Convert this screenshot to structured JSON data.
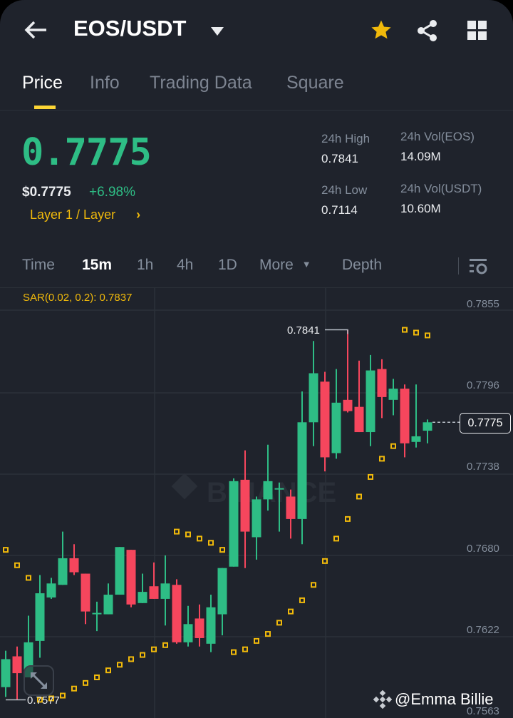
{
  "header": {
    "title": "EOS/USDT",
    "icons": [
      "back-arrow-icon",
      "caret-down-icon",
      "star-icon",
      "share-icon",
      "grid-icon"
    ]
  },
  "tabs": [
    {
      "label": "Price"
    },
    {
      "label": "Info"
    },
    {
      "label": "Trading Data"
    },
    {
      "label": "Square"
    }
  ],
  "ticker": {
    "last_price": "0.7775",
    "usd_price": "$0.7775",
    "change": "+6.98%",
    "category": "Layer 1 / Layer",
    "high_label": "24h High",
    "high": "0.7841",
    "low_label": "24h Low",
    "low": "0.7114",
    "vol_base_label": "24h Vol(EOS)",
    "vol_base": "14.09M",
    "vol_quote_label": "24h Vol(USDT)",
    "vol_quote": "10.60M"
  },
  "timeframes": {
    "items": [
      "Time",
      "15m",
      "1h",
      "4h",
      "1D",
      "More"
    ],
    "active": "15m",
    "depth": "Depth"
  },
  "indicator": {
    "label": "SAR(0.02, 0.2): 0.7837"
  },
  "watermark": "BINANCE",
  "credit": "@Emma Billie",
  "colors": {
    "up": "#2ebd85",
    "down": "#f6465d",
    "sar": "#f0b90b",
    "accent": "#fcd535"
  },
  "chart_data": {
    "type": "candlestick",
    "interval": "15m",
    "y_ticks": [
      "0.7855",
      "0.7796",
      "0.7738",
      "0.7680",
      "0.7622",
      "0.7563"
    ],
    "ylim": [
      0.7563,
      0.7868
    ],
    "current_price": "0.7775",
    "max_label": "0.7841",
    "min_label": "0.7577",
    "candles": [
      [
        0.7586,
        0.7612,
        0.7579,
        0.7606
      ],
      [
        0.7608,
        0.7615,
        0.7577,
        0.7596
      ],
      [
        0.7593,
        0.7637,
        0.7593,
        0.7618
      ],
      [
        0.7619,
        0.7666,
        0.7607,
        0.7653
      ],
      [
        0.765,
        0.7664,
        0.7649,
        0.766
      ],
      [
        0.7659,
        0.7697,
        0.7659,
        0.7678
      ],
      [
        0.7678,
        0.7688,
        0.7666,
        0.7668
      ],
      [
        0.7667,
        0.7667,
        0.7631,
        0.764
      ],
      [
        0.7638,
        0.7647,
        0.7626,
        0.7639
      ],
      [
        0.7638,
        0.766,
        0.7638,
        0.7652
      ],
      [
        0.7652,
        0.7686,
        0.7652,
        0.7686
      ],
      [
        0.7684,
        0.7684,
        0.7643,
        0.7645
      ],
      [
        0.7646,
        0.7667,
        0.7646,
        0.7654
      ],
      [
        0.7658,
        0.7675,
        0.7649,
        0.7649
      ],
      [
        0.7649,
        0.768,
        0.763,
        0.766
      ],
      [
        0.7659,
        0.7663,
        0.7617,
        0.7618
      ],
      [
        0.7618,
        0.7644,
        0.7615,
        0.7631
      ],
      [
        0.7635,
        0.7645,
        0.7615,
        0.7621
      ],
      [
        0.7617,
        0.7652,
        0.7611,
        0.7643
      ],
      [
        0.7638,
        0.7671,
        0.7623,
        0.7671
      ],
      [
        0.7672,
        0.7735,
        0.7672,
        0.7733
      ],
      [
        0.7734,
        0.7755,
        0.7671,
        0.7697
      ],
      [
        0.7693,
        0.7722,
        0.7677,
        0.772
      ],
      [
        0.772,
        0.7759,
        0.7712,
        0.7733
      ],
      [
        0.7727,
        0.7732,
        0.7697,
        0.7728
      ],
      [
        0.7722,
        0.7727,
        0.7692,
        0.7706
      ],
      [
        0.7706,
        0.7797,
        0.7688,
        0.7775
      ],
      [
        0.7775,
        0.7833,
        0.7758,
        0.781
      ],
      [
        0.7804,
        0.7811,
        0.774,
        0.775
      ],
      [
        0.7753,
        0.7813,
        0.7749,
        0.7789
      ],
      [
        0.7791,
        0.7841,
        0.7782,
        0.7783
      ],
      [
        0.7786,
        0.7819,
        0.7768,
        0.7768
      ],
      [
        0.7768,
        0.7823,
        0.7758,
        0.7812
      ],
      [
        0.7813,
        0.782,
        0.7778,
        0.7793
      ],
      [
        0.7791,
        0.7806,
        0.778,
        0.7799
      ],
      [
        0.7799,
        0.7802,
        0.775,
        0.776
      ],
      [
        0.7761,
        0.7802,
        0.7757,
        0.7765
      ],
      [
        0.7769,
        0.7777,
        0.776,
        0.7775
      ]
    ],
    "sar": [
      0.7684,
      0.7673,
      0.7664,
      0.7577,
      0.7578,
      0.758,
      0.7585,
      0.7589,
      0.7593,
      0.7598,
      0.7602,
      0.7606,
      0.7609,
      0.7613,
      0.7616,
      0.7697,
      0.7695,
      0.7692,
      0.7689,
      0.7684,
      0.7611,
      0.7613,
      0.7619,
      0.7624,
      0.7632,
      0.764,
      0.7648,
      0.7659,
      0.7676,
      0.7692,
      0.7706,
      0.7722,
      0.7736,
      0.7749,
      0.7758,
      0.7841,
      0.7839,
      0.7837
    ]
  }
}
